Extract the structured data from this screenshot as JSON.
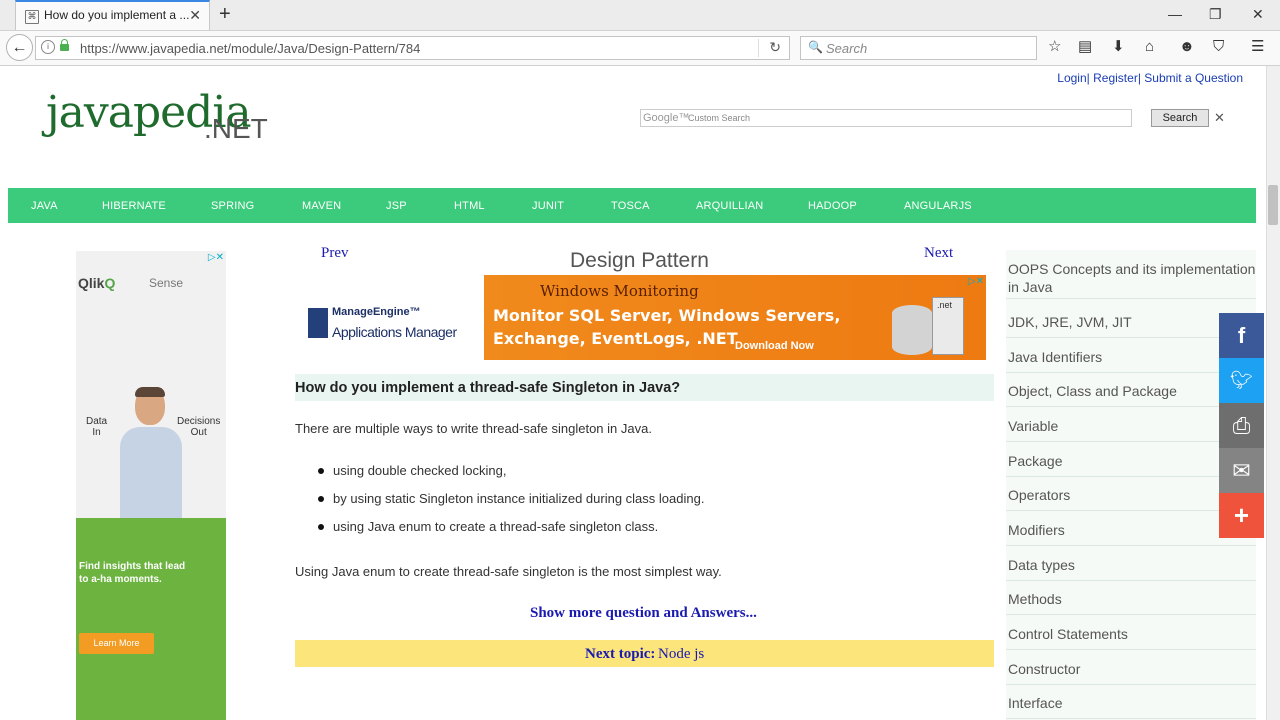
{
  "browser": {
    "tab_title": "How do you implement a ...",
    "new_tab": "+",
    "url": "https://www.javapedia.net/module/Java/Design-Pattern/784",
    "search_placeholder": "Search",
    "window_controls": {
      "minimize": "—",
      "restore": "❐",
      "close": "✕"
    },
    "toolbar_icons": [
      "star-icon",
      "reading-list-icon",
      "download-icon",
      "home-icon",
      "chat-icon",
      "pocket-icon",
      "menu-icon"
    ]
  },
  "site": {
    "top_links": {
      "login": "Login",
      "register": "Register",
      "submit": "Submit a Question",
      "sep": "|"
    },
    "logo_main": "javapedia",
    "logo_suffix": ".NET",
    "google_label": "Google™",
    "custom_search": "Custom Search",
    "search_button": "Search",
    "clear": "✕",
    "menu": [
      "JAVA",
      "HIBERNATE",
      "SPRING",
      "MAVEN",
      "JSP",
      "HTML",
      "JUNIT",
      "TOSCA",
      "ARQUILLIAN",
      "HADOOP",
      "ANGULARJS"
    ],
    "accent": "#3ccb7c"
  },
  "left_ad": {
    "brand": "Qlik",
    "brand_q": "Q",
    "product": "Sense",
    "left_label_1": "Data",
    "left_label_2": "In",
    "right_label_1": "Decisions",
    "right_label_2": "Out",
    "insights_1": "Find insights that lead",
    "insights_2": "to a-ha moments.",
    "cta": "Learn More"
  },
  "content": {
    "prev": "Prev",
    "next": "Next",
    "title": "Design Pattern",
    "banner": {
      "brand_line1": "ManageEngine™",
      "brand_line2": "Applications Manager",
      "heading": "Windows Monitoring",
      "line1": "Monitor SQL Server, Windows Servers,",
      "line2": "Exchange, EventLogs, .NET",
      "cta": "Download Now",
      "net_label": ".net"
    },
    "question": "How do you implement a thread-safe Singleton in Java?",
    "intro": "There are multiple ways to write thread-safe singleton in Java.",
    "bullets": [
      "using double checked locking,",
      "by using static Singleton instance initialized during class loading.",
      "using Java enum to create a thread-safe singleton class."
    ],
    "conclusion": "Using Java enum to create thread-safe singleton is the most simplest way.",
    "show_more": "Show more question and Answers...",
    "next_topic_label": "Next topic:",
    "next_topic_value": "Node js"
  },
  "sidebar": {
    "items": [
      "OOPS Concepts and its implementation in Java",
      "JDK, JRE, JVM, JIT",
      "Java Identifiers",
      "Object, Class and Package",
      "Variable",
      "Package",
      "Operators",
      "Modifiers",
      "Data types",
      "Methods",
      "Control Statements",
      "Constructor",
      "Interface"
    ]
  },
  "share": [
    {
      "name": "facebook",
      "glyph": "f",
      "color": "#3b5998"
    },
    {
      "name": "twitter",
      "glyph": "🐦",
      "color": "#1da1f2"
    },
    {
      "name": "print",
      "glyph": "⎙",
      "color": "#6e6e6e"
    },
    {
      "name": "email",
      "glyph": "✉",
      "color": "#848484"
    },
    {
      "name": "more",
      "glyph": "+",
      "color": "#f0533b"
    }
  ]
}
